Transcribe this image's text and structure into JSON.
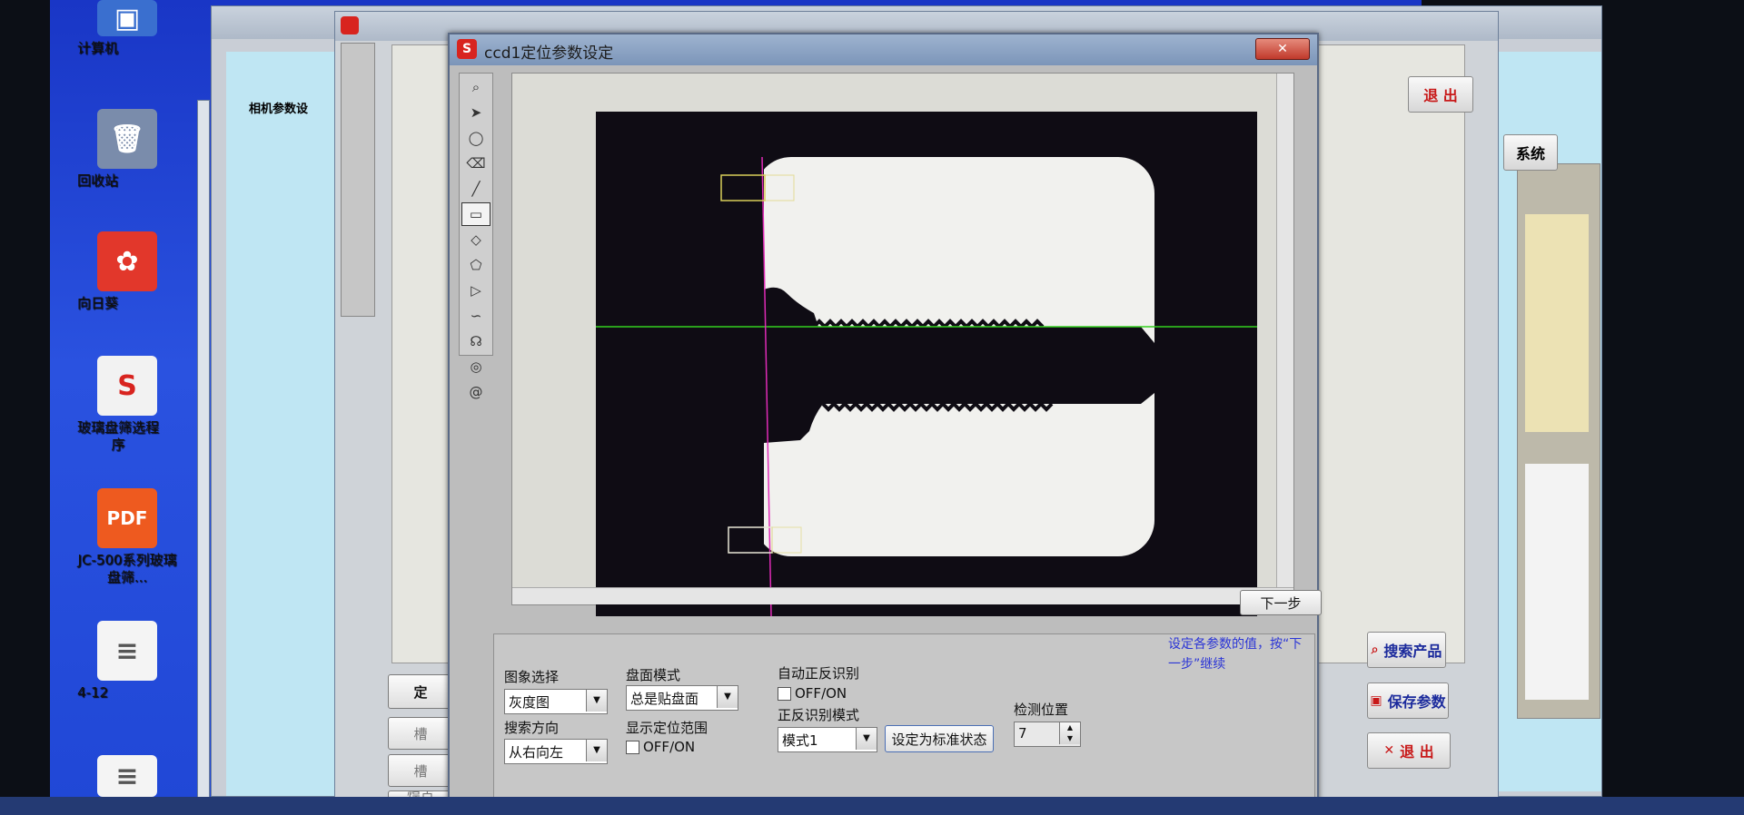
{
  "desktop": {
    "icons": [
      {
        "label": "计算机",
        "color": "#3a6fcf",
        "glyph": "▣"
      },
      {
        "label": "回收站",
        "color": "#7a8cab",
        "glyph": "🗑"
      },
      {
        "label": "向日葵",
        "color": "#e2372b",
        "glyph": "✿"
      },
      {
        "label": "玻璃盘筛选程序",
        "color": "#f2f2f2",
        "glyph": "S"
      },
      {
        "label": "JC-500系列玻璃盘筛...",
        "color": "#ee5a1f",
        "glyph": "PDF"
      },
      {
        "label": "4-12",
        "color": "#f4f4f4",
        "glyph": "≡"
      }
    ]
  },
  "background_windows": {
    "left_label": "相机参数设",
    "main_buttons": {
      "exit_top": "退 出",
      "system": "系统",
      "search_product": "搜索产品",
      "save_params": "保存参数",
      "exit": "退 出"
    },
    "left_fragments": [
      "定",
      "槽",
      "槽",
      "焊点"
    ]
  },
  "dialog": {
    "title": "ccd1定位参数设定",
    "close_label": "✕",
    "next_button": "下一步",
    "hint_text": "设定各参数的值，按“下一步”继续",
    "toolbar_tools": [
      "zoom-icon",
      "pointer-icon",
      "circle-icon",
      "eraser-icon",
      "line-icon",
      "rectangle-icon",
      "diamond-icon",
      "polygon-icon",
      "shape-icon",
      "curve-icon",
      "lasso-icon",
      "ring-icon",
      "spiral-icon"
    ],
    "settings": {
      "image_select": {
        "label": "图象选择",
        "value": "灰度图"
      },
      "surface_mode": {
        "label": "盘面模式",
        "value": "总是贴盘面"
      },
      "auto_detect": {
        "label": "自动正反识别",
        "option": "OFF/ON"
      },
      "search_direction": {
        "label": "搜索方向",
        "value": "从右向左"
      },
      "show_range": {
        "label": "显示定位范围",
        "option": "OFF/ON"
      },
      "detect_mode": {
        "label": "正反识别模式",
        "value": "模式1"
      },
      "set_standard_button": "设定为标准状态",
      "detect_position": {
        "label": "检测位置",
        "value": "7"
      }
    }
  },
  "colors": {
    "accent": "#d8241f",
    "hint": "#2b35d6",
    "green_line": "#34d11e",
    "magenta_line": "#e02bb7",
    "roi_box": "#d9cf5a"
  }
}
